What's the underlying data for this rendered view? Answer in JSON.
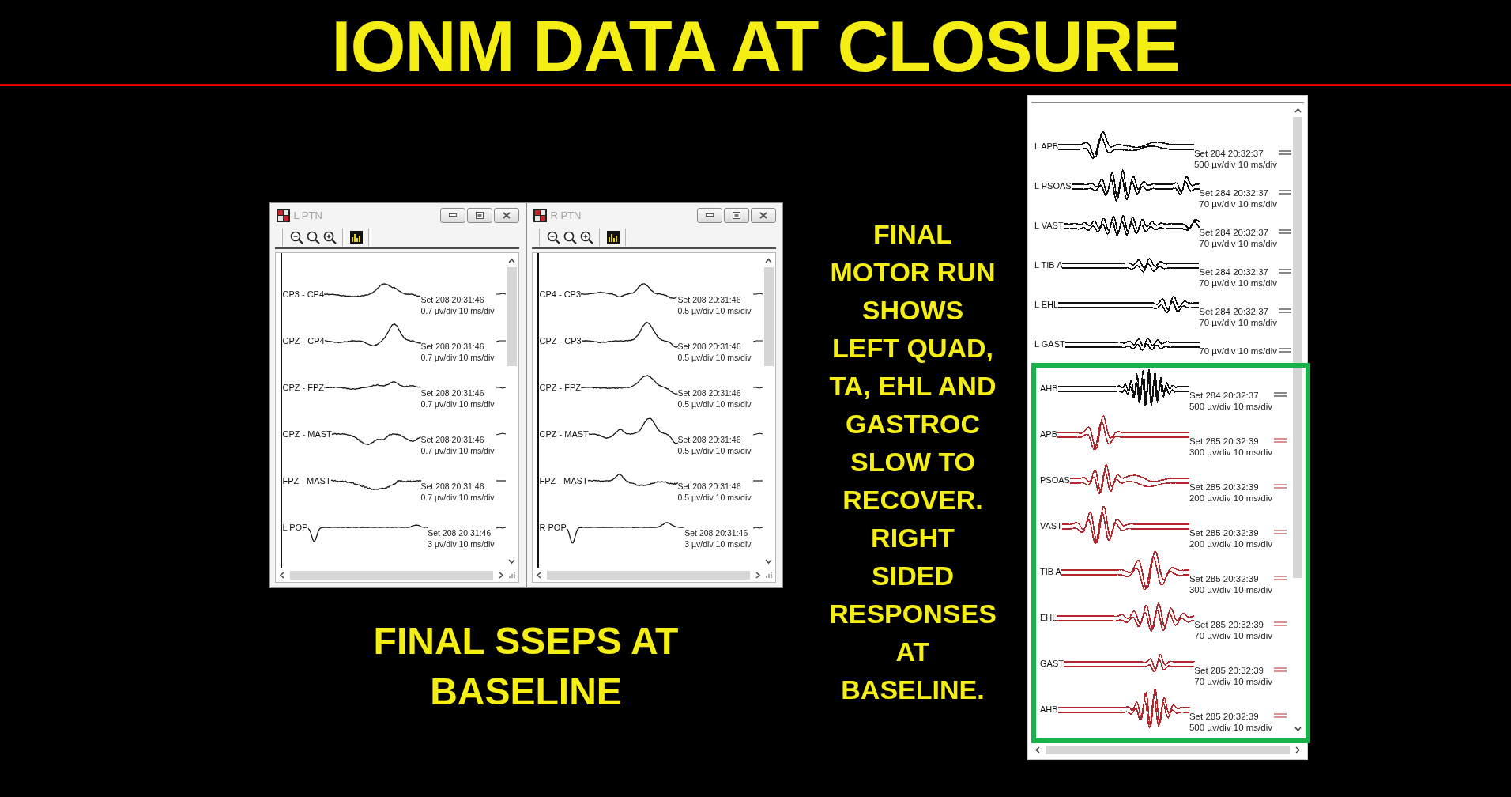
{
  "title": "IONM DATA AT CLOSURE",
  "sseps": {
    "windows": [
      {
        "title": "L PTN",
        "active": false,
        "traces": [
          {
            "label": "CP3 - CP4",
            "set": "Set 208 20:31:46",
            "scale": "0.7 µv/div 10 ms/div"
          },
          {
            "label": "CPZ - CP4",
            "set": "Set 208 20:31:46",
            "scale": "0.7 µv/div 10 ms/div"
          },
          {
            "label": "CPZ - FPZ",
            "set": "Set 208 20:31:46",
            "scale": "0.7 µv/div 10 ms/div"
          },
          {
            "label": "CPZ - MAST",
            "set": "Set 208 20:31:46",
            "scale": "0.7 µv/div 10 ms/div"
          },
          {
            "label": "FPZ - MAST",
            "set": "Set 208 20:31:46",
            "scale": "0.7 µv/div 10 ms/div"
          },
          {
            "label": "L POP",
            "set": "Set 208 20:31:46",
            "scale": "3 µv/div 10 ms/div"
          }
        ]
      },
      {
        "title": "R PTN",
        "active": false,
        "traces": [
          {
            "label": "CP4 - CP3",
            "set": "Set 208 20:31:46",
            "scale": "0.5 µv/div 10 ms/div"
          },
          {
            "label": "CPZ - CP3",
            "set": "Set 208 20:31:46",
            "scale": "0.5 µv/div 10 ms/div"
          },
          {
            "label": "CPZ - FPZ",
            "set": "Set 208 20:31:46",
            "scale": "0.5 µv/div 10 ms/div"
          },
          {
            "label": "CPZ - MAST",
            "set": "Set 208 20:31:46",
            "scale": "0.5 µv/div 10 ms/div"
          },
          {
            "label": "FPZ - MAST",
            "set": "Set 208 20:31:46",
            "scale": "0.5 µv/div 10 ms/div"
          },
          {
            "label": "R POP",
            "set": "Set 208 20:31:46",
            "scale": "3 µv/div 10 ms/div"
          }
        ]
      }
    ],
    "caption": {
      "lines": [
        "FINAL SSEPS AT",
        "BASELINE"
      ]
    }
  },
  "note": {
    "lines": [
      "FINAL",
      "MOTOR RUN",
      "SHOWS",
      "LEFT QUAD,",
      "TA, EHL AND",
      "GASTROC",
      "SLOW TO",
      "RECOVER.",
      "RIGHT",
      "SIDED",
      "RESPONSES",
      "AT",
      "BASELINE."
    ]
  },
  "motor_panel": {
    "rows": [
      {
        "label": "L APB",
        "set": "Set 284 20:32:37",
        "scale": "500 µv/div 10 ms/div",
        "color": "#111111"
      },
      {
        "label": "L PSOAS",
        "set": "Set 284 20:32:37",
        "scale": "70 µv/div 10 ms/div",
        "color": "#111111"
      },
      {
        "label": "L VAST",
        "set": "Set 284 20:32:37",
        "scale": "70 µv/div 10 ms/div",
        "color": "#111111"
      },
      {
        "label": "L TIB A",
        "set": "Set 284 20:32:37",
        "scale": "70 µv/div 10 ms/div",
        "color": "#111111"
      },
      {
        "label": "L EHL",
        "set": "Set 284 20:32:37",
        "scale": "70 µv/div 10 ms/div",
        "color": "#111111"
      },
      {
        "label": "L GAST",
        "scale": "70 µv/div 10 ms/div",
        "color": "#111111"
      }
    ],
    "highlight_box": {
      "rows": [
        {
          "label": "AHB",
          "set": "Set 284 20:32:37",
          "scale": "500 µv/div 10 ms/div",
          "color": "#111111"
        },
        {
          "label": "APB",
          "set": "Set 285 20:32:39",
          "scale": "300 µv/div 10 ms/div",
          "color": "#b3262b"
        },
        {
          "label": "PSOAS",
          "set": "Set 285 20:32:39",
          "scale": "200 µv/div 10 ms/div",
          "color": "#b3262b"
        },
        {
          "label": "VAST",
          "set": "Set 285 20:32:39",
          "scale": "200 µv/div 10 ms/div",
          "color": "#b3262b"
        },
        {
          "label": "TIB A",
          "set": "Set 285 20:32:39",
          "scale": "300 µv/div 10 ms/div",
          "color": "#b3262b"
        },
        {
          "label": "EHL",
          "set": "Set 285 20:32:39",
          "scale": "70 µv/div 10 ms/div",
          "color": "#b3262b"
        },
        {
          "label": "GAST",
          "set": "Set 285 20:32:39",
          "scale": "70 µv/div 10 ms/div",
          "color": "#b3262b"
        },
        {
          "label": "AHB",
          "set": "Set 285 20:32:39",
          "scale": "500 µv/div 10 ms/div",
          "color": "#b3262b"
        }
      ]
    }
  }
}
